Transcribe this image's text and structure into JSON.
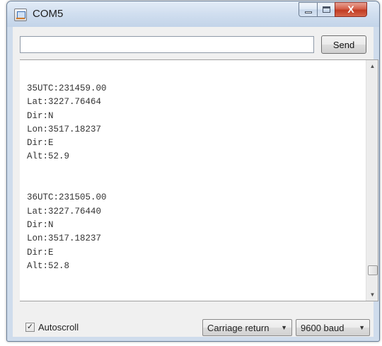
{
  "window": {
    "title": "COM5",
    "app_icon": "serial-monitor-icon",
    "controls": {
      "minimize_icon": "minimize-icon",
      "maximize_icon": "maximize-icon",
      "close_icon": "close-icon",
      "close_glyph": "X"
    }
  },
  "input": {
    "value": "",
    "placeholder": "",
    "send_label": "Send"
  },
  "log": {
    "lines": [
      "35UTC:231459.00",
      "Lat:3227.76464",
      "Dir:N",
      "Lon:3517.18237",
      "Dir:E",
      "Alt:52.9",
      "",
      "",
      "36UTC:231505.00",
      "Lat:3227.76440",
      "Dir:N",
      "Lon:3517.18237",
      "Dir:E",
      "Alt:52.8"
    ]
  },
  "scrollbar": {
    "up_glyph": "▲",
    "down_glyph": "▼"
  },
  "footer": {
    "autoscroll_label": "Autoscroll",
    "autoscroll_checked": true,
    "check_glyph": "✓",
    "line_ending": "Carriage return",
    "baud_rate": "9600 baud",
    "dropdown_glyph": "▼"
  },
  "colors": {
    "frame": "#cfdcec",
    "close_button": "#c13b22",
    "log_background": "#ffffff"
  }
}
